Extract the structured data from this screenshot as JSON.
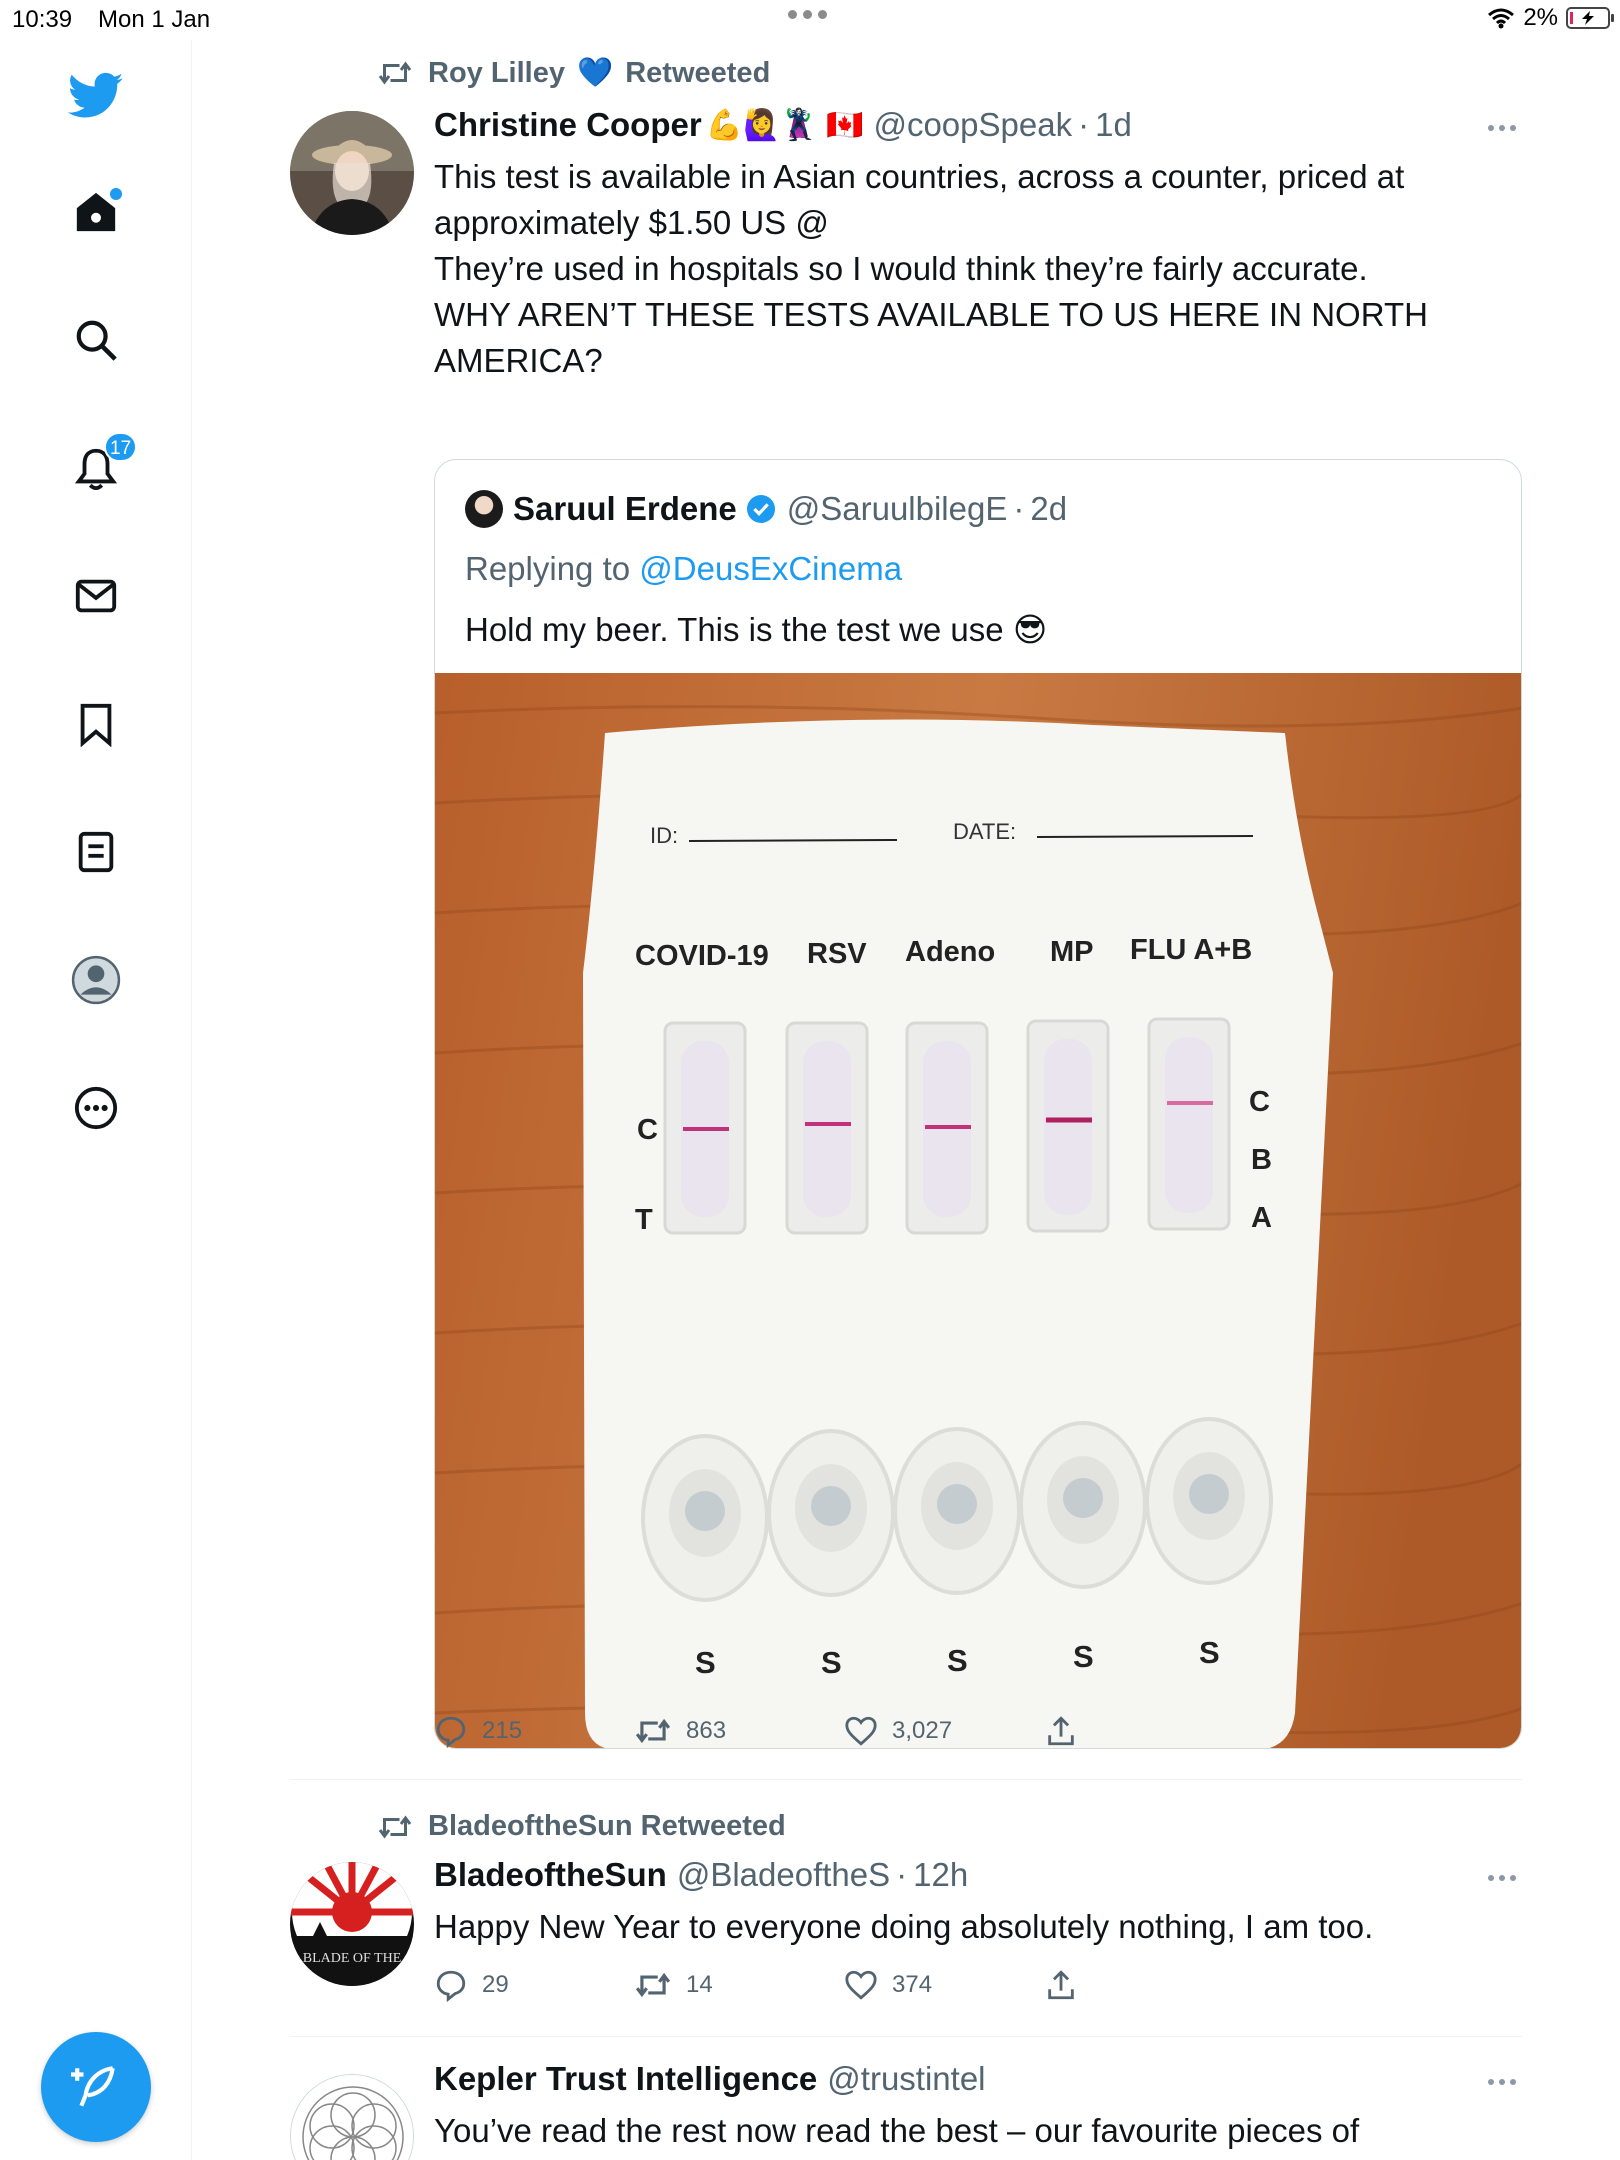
{
  "status_bar": {
    "time": "10:39",
    "date": "Mon 1 Jan",
    "battery": "2%"
  },
  "nav": {
    "items": [
      "home-icon",
      "search-icon",
      "notifications-icon",
      "messages-icon",
      "bookmarks-icon",
      "lists-icon",
      "profile-icon",
      "more-icon"
    ],
    "notification_count": "17",
    "accent": "#1d9bf0"
  },
  "tweets": [
    {
      "retweeted_by": "Roy Lilley",
      "retweeted_heart": "💙",
      "retweeted_suffix": "Retweeted",
      "author_name": "Christine Cooper",
      "author_emoji": "💪🙋‍♀️🦹‍♀️ 🇨🇦",
      "handle": "@coopSpeak",
      "time": "1d",
      "text": "This test is available in Asian countries, across a counter, priced at\napproximately $1.50 US @\nThey’re used in hospitals so I would think they’re fairly accurate.\nWHY AREN’T THESE TESTS AVAILABLE TO US HERE IN NORTH\nAMERICA?",
      "quote": {
        "author_name": "Saruul Erdene",
        "handle": "@SaruulbilegE",
        "time": "2d",
        "replying_prefix": "Replying to",
        "replying_to": "@DeusExCinema",
        "text": "Hold my beer. This is the test we use",
        "text_emoji": "😎",
        "media": {
          "id_label": "ID:",
          "date_label": "DATE:",
          "columns": [
            "COVID-19",
            "RSV",
            "Adeno",
            "MP",
            "FLU A+B"
          ],
          "left_markers": [
            "C",
            "T"
          ],
          "right_markers": [
            "C",
            "B",
            "A"
          ],
          "sample_label": "S"
        }
      },
      "replies": "215",
      "retweets": "863",
      "likes": "3,027"
    },
    {
      "retweeted_by": "BladeoftheSun Retweeted",
      "author_name": "BladeoftheSun",
      "handle": "@BladeoftheS",
      "time": "12h",
      "text": "Happy New Year to everyone doing absolutely nothing, I am too.",
      "avatar_text": "BLADE OF THE",
      "replies": "29",
      "retweets": "14",
      "likes": "374"
    },
    {
      "author_name": "Kepler Trust Intelligence",
      "handle": "@trustintel",
      "text": "You’ve read the rest now read the best – our favourite pieces of"
    }
  ]
}
